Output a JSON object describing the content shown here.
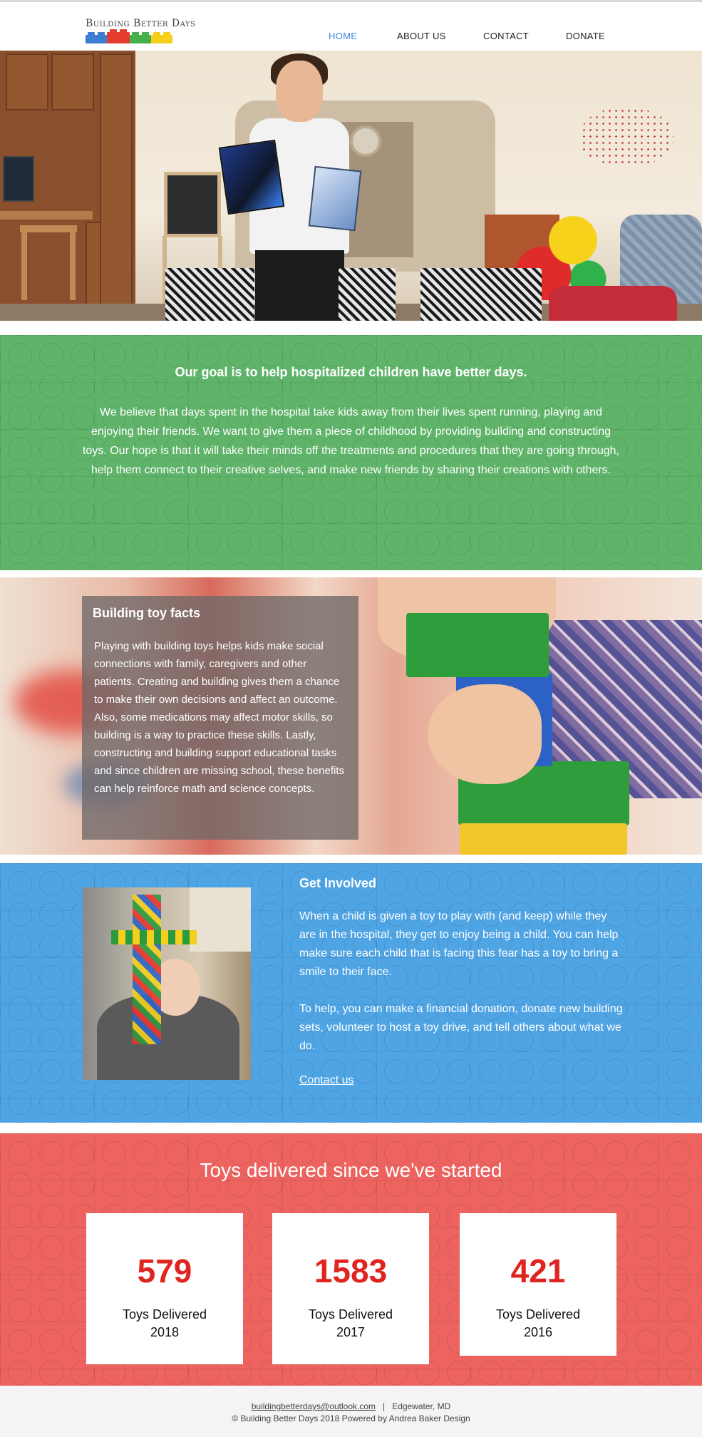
{
  "header": {
    "logo_text": "Building Better Days",
    "nav": [
      "HOME",
      "ABOUT US",
      "CONTACT",
      "DONATE"
    ],
    "active_nav": "HOME"
  },
  "goal": {
    "title": "Our goal is to help hospitalized children have better days.",
    "body": "We believe that days spent in the hospital take kids away from their lives spent running, playing and enjoying their friends. We want to give them a piece of childhood by providing building and constructing toys. Our hope is that it will take their minds off the treatments and procedures that they are going through, help them connect to their creative selves, and make new friends by sharing their creations with others."
  },
  "facts": {
    "title": "Building toy facts",
    "body": "Playing with building toys helps kids make social connections with family, caregivers and other patients. Creating and building gives them a chance to make their own decisions and affect an outcome. Also, some medications may affect motor skills, so building is a way to practice these skills. Lastly, constructing and building support educational tasks and since children are missing school, these benefits can help reinforce math and science concepts."
  },
  "involved": {
    "title": "Get Involved",
    "paragraph1": "When a child is given a toy to play with (and keep) while they are in the hospital, they get to enjoy being a child. You can help make sure each child that is facing this fear has a toy to bring a smile to their face.",
    "paragraph2": "To help, you can make a financial donation, donate new building sets, volunteer to host a toy drive, and tell others about what we do.",
    "link": "Contact us"
  },
  "stats": {
    "title": "Toys delivered since we've started",
    "cards": [
      {
        "number": "579",
        "label": "Toys Delivered",
        "year": "2018"
      },
      {
        "number": "1583",
        "label": "Toys Delivered",
        "year": "2017"
      },
      {
        "number": "421",
        "label": "Toys Delivered",
        "year": "2016"
      }
    ]
  },
  "footer": {
    "email": "buildingbetterdays@outlook.com",
    "separator": "|",
    "location": "Edgewater, MD",
    "copyright": "© Building Better Days 2018 Powered by Andrea Baker Design"
  },
  "colors": {
    "green_section": "#5fb46a",
    "blue_section": "#4fa4e4",
    "red_section": "#ec6360",
    "stat_number": "#e0241f",
    "nav_active": "#3a87d9"
  }
}
